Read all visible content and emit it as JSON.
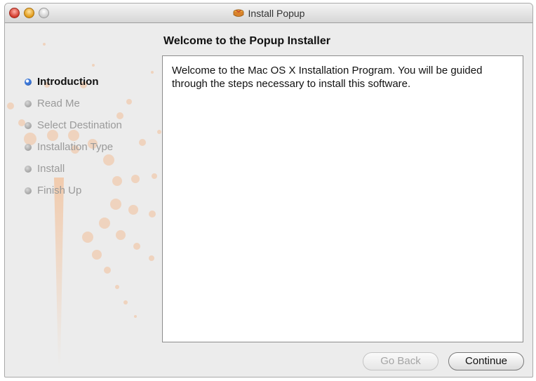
{
  "window": {
    "title": "Install Popup",
    "title_icon": "installer-package-icon"
  },
  "heading": "Welcome to the Popup Installer",
  "steps": [
    {
      "label": "Introduction",
      "state": "current"
    },
    {
      "label": "Read Me",
      "state": "pending"
    },
    {
      "label": "Select Destination",
      "state": "pending"
    },
    {
      "label": "Installation Type",
      "state": "pending"
    },
    {
      "label": "Install",
      "state": "pending"
    },
    {
      "label": "Finish Up",
      "state": "pending"
    }
  ],
  "content": {
    "text": "Welcome to the Mac OS X Installation Program. You will be guided through the steps necessary to install this software."
  },
  "buttons": {
    "go_back": "Go Back",
    "go_back_enabled": false,
    "continue": "Continue"
  },
  "colors": {
    "accent_orange": "#f5a56a",
    "active_bullet": "#3c77d6"
  }
}
